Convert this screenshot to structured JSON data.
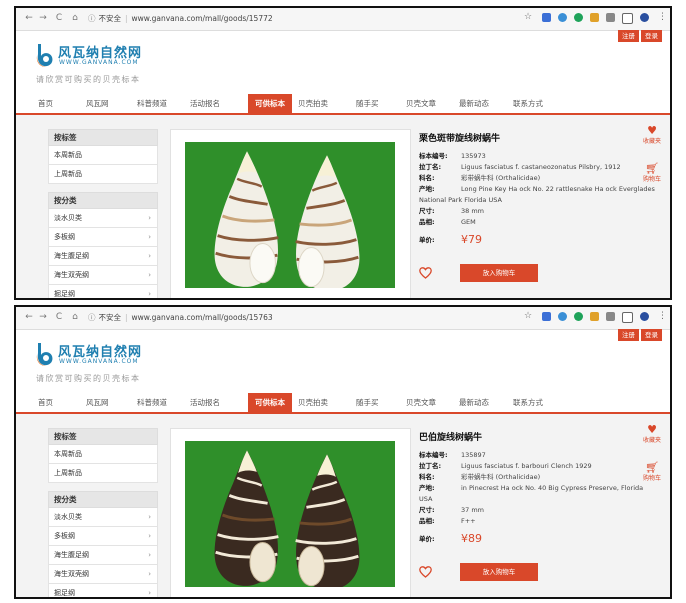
{
  "frames": [
    {
      "browser": {
        "not_secure": "不安全",
        "url": "www.ganvana.com/mall/goods/15772"
      },
      "top_buttons": [
        "注册",
        "登录"
      ],
      "logo": {
        "cn": "风瓦纳自然网",
        "en": "WWW.GANVANA.COM"
      },
      "slogan": "请欣赏可购买的贝壳标本",
      "nav": [
        "首页",
        "风瓦网",
        "科普频道",
        "活动报名",
        "可供标本",
        "贝壳拍卖",
        "随手买",
        "贝壳文章",
        "最新动态",
        "联系方式"
      ],
      "sidebar": {
        "group1_title": "按标签",
        "group1": [
          "本周新品",
          "上周新品"
        ],
        "group2_title": "按分类",
        "group2": [
          "淡水贝类",
          "多板纲",
          "海生腹足纲",
          "海生双壳纲",
          "掘足纲"
        ]
      },
      "product": {
        "title": "栗色斑带旋线树蜗牛",
        "fields": [
          {
            "k": "标本编号:",
            "v": "135973"
          },
          {
            "k": "拉丁名:",
            "v": "Liguus fasciatus f. castaneozonatus Pilsbry, 1912"
          },
          {
            "k": "科名:",
            "v": "彩带蜗牛科 (Orthalicidae)"
          },
          {
            "k": "产地:",
            "v": "Long Pine Key Ha ock No. 22 rattlesnake Ha ock Everglades National Park Florida USA"
          },
          {
            "k": "尺寸:",
            "v": "38 mm"
          },
          {
            "k": "品相:",
            "v": "GEM"
          }
        ],
        "price_label": "单价:",
        "price": "¥79",
        "cart_button": "放入购物车",
        "shell_style": "white"
      },
      "rail": {
        "fav": "收藏夹",
        "cart": "购物车"
      }
    },
    {
      "browser": {
        "not_secure": "不安全",
        "url": "www.ganvana.com/mall/goods/15763"
      },
      "top_buttons": [
        "注册",
        "登录"
      ],
      "logo": {
        "cn": "风瓦纳自然网",
        "en": "WWW.GANVANA.COM"
      },
      "slogan": "请欣赏可购买的贝壳标本",
      "nav": [
        "首页",
        "风瓦网",
        "科普频道",
        "活动报名",
        "可供标本",
        "贝壳拍卖",
        "随手买",
        "贝壳文章",
        "最新动态",
        "联系方式"
      ],
      "sidebar": {
        "group1_title": "按标签",
        "group1": [
          "本周新品",
          "上周新品"
        ],
        "group2_title": "按分类",
        "group2": [
          "淡水贝类",
          "多板纲",
          "海生腹足纲",
          "海生双壳纲",
          "掘足纲"
        ]
      },
      "product": {
        "title": "巴伯旋线树蜗牛",
        "fields": [
          {
            "k": "标本编号:",
            "v": "135897"
          },
          {
            "k": "拉丁名:",
            "v": "Liguus fasciatus f. barbouri Clench 1929"
          },
          {
            "k": "科名:",
            "v": "彩带蜗牛科 (Orthalicidae)"
          },
          {
            "k": "产地:",
            "v": "in Pinecrest Ha ock No. 40 Big Cypress Preserve, Florida USA"
          },
          {
            "k": "尺寸:",
            "v": "37 mm"
          },
          {
            "k": "品相:",
            "v": "F++"
          }
        ],
        "price_label": "单价:",
        "price": "¥89",
        "cart_button": "放入购物车",
        "shell_style": "dark"
      },
      "rail": {
        "fav": "收藏夹",
        "cart": "购物车"
      }
    }
  ],
  "colors": {
    "accent": "#d9482a",
    "brand_blue": "#1f7fb0",
    "image_bg": "#2f8f2a"
  }
}
